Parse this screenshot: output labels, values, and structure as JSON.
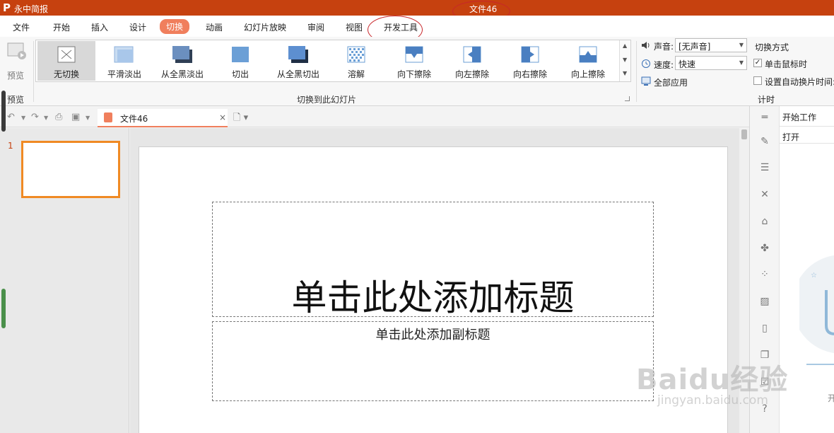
{
  "app": {
    "name": "永中简报",
    "logo_letter": "P",
    "document_title": "文件46"
  },
  "menu": {
    "items": [
      "文件",
      "开始",
      "插入",
      "设计",
      "切换",
      "动画",
      "幻灯片放映",
      "审阅",
      "视图",
      "开发工具"
    ],
    "active": "切换"
  },
  "ribbon": {
    "preview_label": "预览",
    "preview_group_label": "预览",
    "effects": [
      "无切换",
      "平滑淡出",
      "从全黑淡出",
      "切出",
      "从全黑切出",
      "溶解",
      "向下擦除",
      "向左擦除",
      "向右擦除",
      "向上擦除"
    ],
    "selected_effect": "无切换",
    "switch_group_label": "切换到此幻灯片",
    "sound_label": "声音:",
    "sound_value": "[无声音]",
    "speed_label": "速度:",
    "speed_value": "快速",
    "apply_all_label": "全部应用",
    "switch_mode_label": "切换方式",
    "on_click_label": "单击鼠标时",
    "on_click_checked": true,
    "auto_advance_label": "设置自动换片时间:",
    "auto_advance_checked": false,
    "timing_group_label": "计时"
  },
  "doc_tab": {
    "name": "文件46",
    "close": "×"
  },
  "slides": {
    "numbers": [
      "1"
    ]
  },
  "slide": {
    "title_placeholder": "单击此处添加标题",
    "subtitle_placeholder": "单击此处添加副标题"
  },
  "taskpane": {
    "header": "开始工作",
    "open_label": "打开",
    "art_caption": "开"
  },
  "watermark": {
    "brand": "Baidu经验",
    "url": "jingyan.baidu.com"
  },
  "colors": {
    "titlebar": "#c6410f",
    "accent": "#f07f5d",
    "thumb_border": "#f08a24",
    "annotation": "#c8262a"
  }
}
